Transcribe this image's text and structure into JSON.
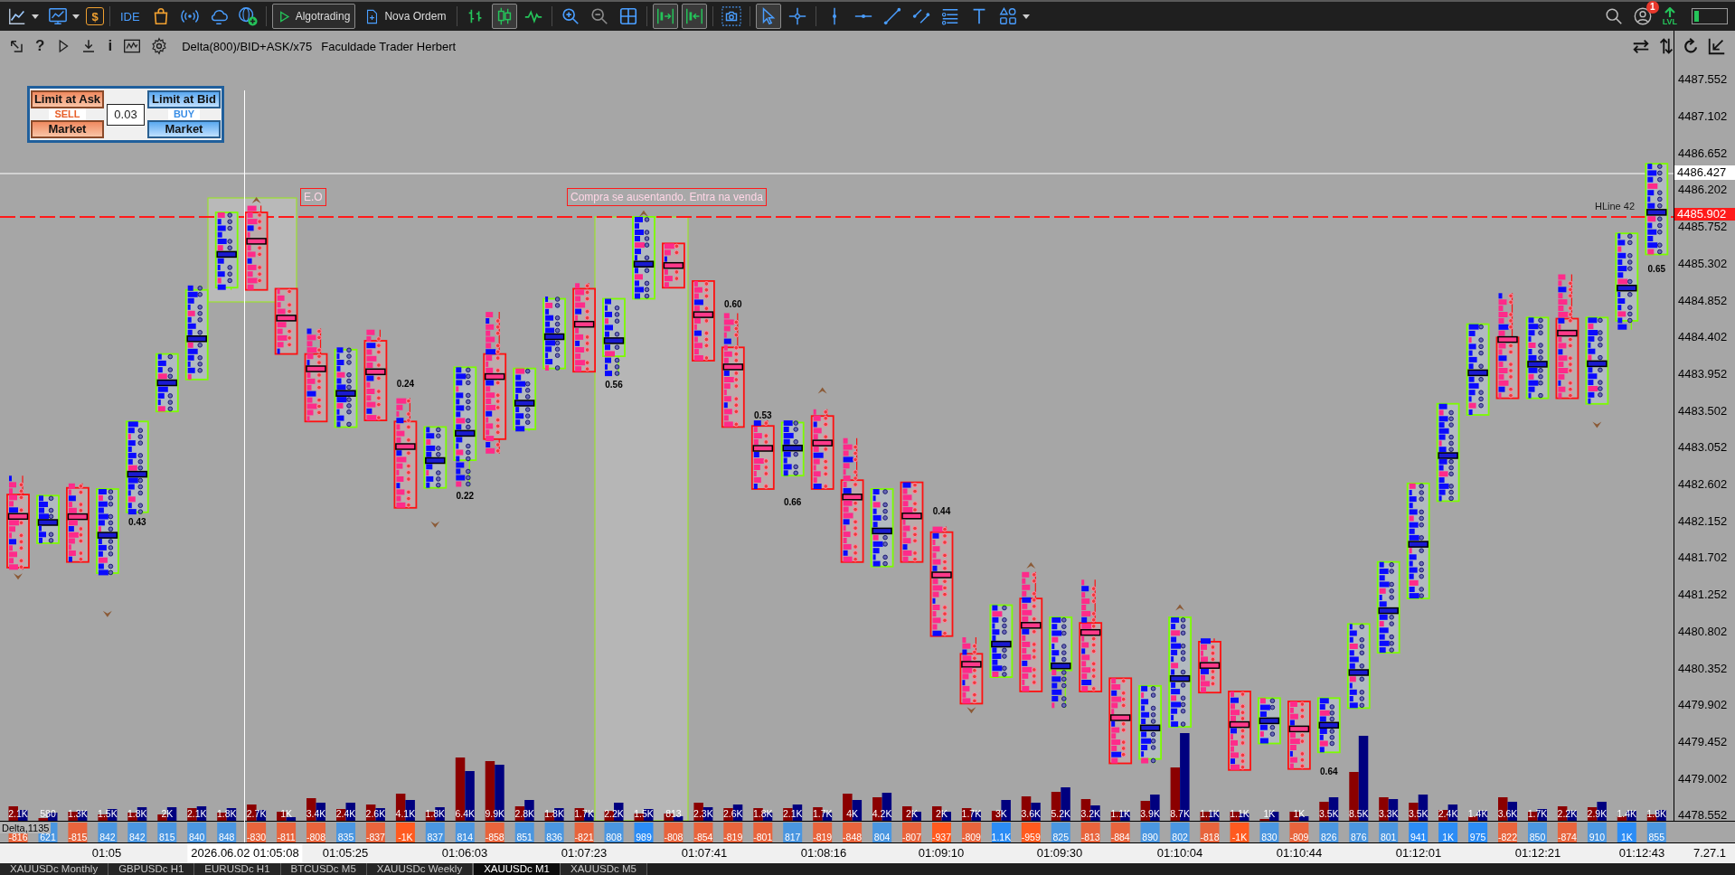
{
  "toolbar": {
    "dollar": "$",
    "ide": "IDE",
    "algotrading": {
      "label": "Algotrading",
      "on": true
    },
    "new_order": "Nova Ordem",
    "chart_types": [
      {
        "kind": "bars",
        "selected": false
      },
      {
        "kind": "candles",
        "selected": true
      },
      {
        "kind": "line",
        "selected": false
      }
    ],
    "auto_scroll": {
      "on": true
    },
    "chart_shift": {
      "on": true
    },
    "pointer_tools": [
      {
        "kind": "cursor",
        "selected": true
      },
      {
        "kind": "crosshair",
        "selected": false
      }
    ],
    "notification_count": "1",
    "level_label": "LVL",
    "progress": {
      "level": 0.15
    }
  },
  "chart_header": {
    "help": "?",
    "info": "i",
    "indicator": "Delta(800)/BID+ASK/x75",
    "caption": "Faculdade Trader Herbert"
  },
  "trade_panel": {
    "sell": {
      "limit": "Limit at Ask",
      "label": "SELL",
      "market": "Market"
    },
    "lot": "0.03",
    "buy": {
      "limit": "Limit at Bid",
      "label": "BUY",
      "market": "Market"
    }
  },
  "chart": {
    "annotations": [
      {
        "kind": "box",
        "text": "E.O"
      },
      {
        "kind": "box",
        "text": "Compra se ausentando. Entra na venda"
      },
      {
        "kind": "line_label",
        "text": "HLine 42"
      }
    ],
    "ratios": [
      "0.43",
      "0.24",
      "0.22",
      "0.56",
      "0.60",
      "0.53",
      "0.66",
      "0.44",
      "0.64",
      "0.65"
    ],
    "price_axis": {
      "ticks": [
        "4487.552",
        "4487.102",
        "4486.652",
        "4486.202",
        "4485.752",
        "4485.302",
        "4484.852",
        "4484.402",
        "4483.952",
        "4483.502",
        "4483.052",
        "4482.602",
        "4482.152",
        "4481.702",
        "4481.252",
        "4480.802",
        "4480.352",
        "4479.902",
        "4479.452",
        "4479.002",
        "4478.552"
      ],
      "crosshair_price": "4486.427",
      "line_price": "4485.902"
    },
    "volume_labels": [
      "2.1K",
      "580",
      "1.3K",
      "1.5K",
      "1.8K",
      "2K",
      "2.1K",
      "1.8K",
      "2.7K",
      "1K",
      "3.4K",
      "2.4K",
      "2.6K",
      "4.1K",
      "1.8K",
      "6.4K",
      "9.9K",
      "2.8K",
      "1.8K",
      "1.7K",
      "2.2K",
      "1.5K",
      "813",
      "2.3K",
      "2.6K",
      "1.8K",
      "2.1K",
      "1.7K",
      "4K",
      "4.2K",
      "2K",
      "2K",
      "1.7K",
      "3K",
      "3.6K",
      "5.2K",
      "3.2K",
      "1.1K",
      "3.9K",
      "8.7K",
      "1.1K",
      "1.1K",
      "1K",
      "1K",
      "3.5K",
      "8.5K",
      "3.3K",
      "3.5K",
      "2.4K",
      "1.4K",
      "3.6K",
      "1.7K",
      "2.2K",
      "2.9K",
      "1.4K",
      "1.8K"
    ],
    "indicator_label": "Delta,1135",
    "delta": [
      {
        "value": "-816",
        "color": "#e8643c"
      },
      {
        "value": "621",
        "color": "#4a96e0"
      },
      {
        "value": "-815",
        "color": "#e8643c"
      },
      {
        "value": "842",
        "color": "#4a96e0"
      },
      {
        "value": "842",
        "color": "#4a96e0"
      },
      {
        "value": "815",
        "color": "#4a96e0"
      },
      {
        "value": "840",
        "color": "#4a96e0"
      },
      {
        "value": "848",
        "color": "#4a96e0"
      },
      {
        "value": "-830",
        "color": "#e8643c"
      },
      {
        "value": "-811",
        "color": "#e8643c"
      },
      {
        "value": "-808",
        "color": "#e8643c"
      },
      {
        "value": "835",
        "color": "#4a96e0"
      },
      {
        "value": "-837",
        "color": "#e8643c"
      },
      {
        "value": "-1K",
        "color": "#ff5a1f"
      },
      {
        "value": "837",
        "color": "#4a96e0"
      },
      {
        "value": "814",
        "color": "#4a96e0"
      },
      {
        "value": "-858",
        "color": "#e8643c"
      },
      {
        "value": "851",
        "color": "#4a96e0"
      },
      {
        "value": "836",
        "color": "#4a96e0"
      },
      {
        "value": "-821",
        "color": "#e8643c"
      },
      {
        "value": "808",
        "color": "#4a96e0"
      },
      {
        "value": "989",
        "color": "#2b8cf5"
      },
      {
        "value": "-808",
        "color": "#e8643c"
      },
      {
        "value": "-854",
        "color": "#e8643c"
      },
      {
        "value": "-819",
        "color": "#e8643c"
      },
      {
        "value": "-801",
        "color": "#e8643c"
      },
      {
        "value": "817",
        "color": "#4a96e0"
      },
      {
        "value": "-819",
        "color": "#e8643c"
      },
      {
        "value": "-848",
        "color": "#e8643c"
      },
      {
        "value": "804",
        "color": "#4a96e0"
      },
      {
        "value": "-807",
        "color": "#e8643c"
      },
      {
        "value": "-937",
        "color": "#ff5a1f"
      },
      {
        "value": "-809",
        "color": "#e8643c"
      },
      {
        "value": "1.1K",
        "color": "#2b8cf5"
      },
      {
        "value": "-959",
        "color": "#ff5a1f"
      },
      {
        "value": "825",
        "color": "#4a96e0"
      },
      {
        "value": "-813",
        "color": "#e8643c"
      },
      {
        "value": "-884",
        "color": "#e8643c"
      },
      {
        "value": "890",
        "color": "#4a96e0"
      },
      {
        "value": "802",
        "color": "#4a96e0"
      },
      {
        "value": "-818",
        "color": "#e8643c"
      },
      {
        "value": "-1K",
        "color": "#ff5a1f"
      },
      {
        "value": "830",
        "color": "#4a96e0"
      },
      {
        "value": "-809",
        "color": "#e8643c"
      },
      {
        "value": "826",
        "color": "#4a96e0"
      },
      {
        "value": "876",
        "color": "#4a96e0"
      },
      {
        "value": "801",
        "color": "#4a96e0"
      },
      {
        "value": "941",
        "color": "#2b8cf5"
      },
      {
        "value": "1K",
        "color": "#2b8cf5"
      },
      {
        "value": "975",
        "color": "#2b8cf5"
      },
      {
        "value": "-822",
        "color": "#e8643c"
      },
      {
        "value": "850",
        "color": "#4a96e0"
      },
      {
        "value": "-874",
        "color": "#e8643c"
      },
      {
        "value": "910",
        "color": "#4a96e0"
      },
      {
        "value": "1K",
        "color": "#2b8cf5"
      },
      {
        "value": "855",
        "color": "#4a96e0"
      }
    ],
    "time_axis": {
      "ticks": [
        "01:05",
        "01:05:25",
        "01:06:03",
        "01:07:23",
        "01:07:41",
        "01:08:16",
        "01:09:10",
        "01:09:30",
        "01:10:04",
        "01:10:44",
        "01:12:01",
        "01:12:21",
        "01:12:43"
      ],
      "crosshair_time": "2026.06.02 01:05:08",
      "corner": "7.27.1"
    }
  },
  "tabs": [
    {
      "label": "XAUUSDc Monthly",
      "selected": false
    },
    {
      "label": "GBPUSDc H1",
      "selected": false
    },
    {
      "label": "EURUSDc H1",
      "selected": false
    },
    {
      "label": "BTCUSDc M5",
      "selected": false
    },
    {
      "label": "XAUUSDc Weekly",
      "selected": false
    },
    {
      "label": "XAUUSDc M1",
      "selected": true
    },
    {
      "label": "XAUUSDc M5",
      "selected": false
    }
  ]
}
